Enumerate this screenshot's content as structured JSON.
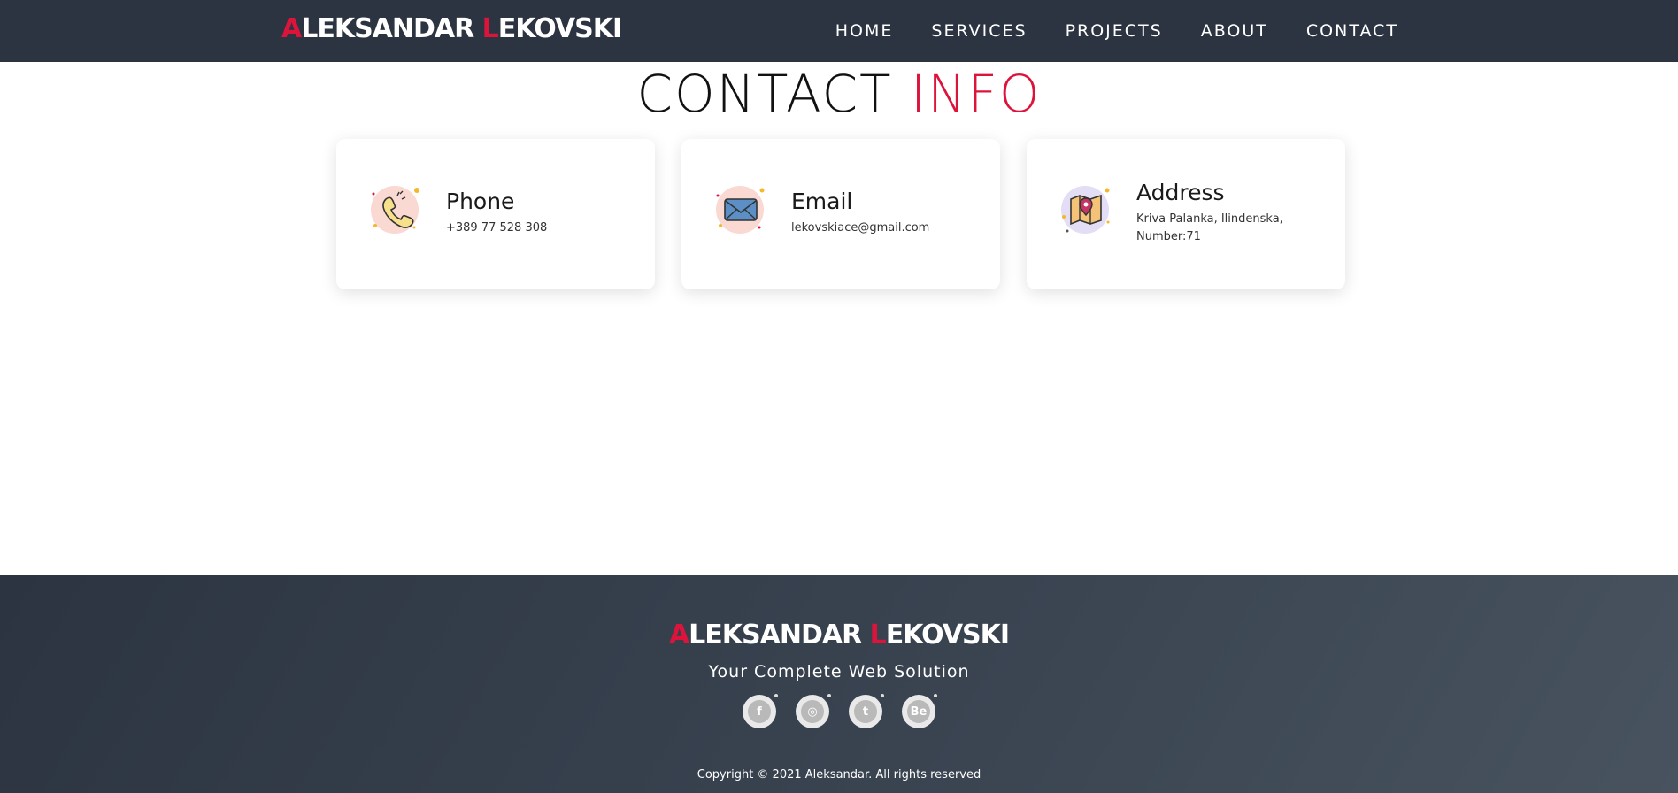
{
  "header": {
    "brand": {
      "a1": "A",
      "rest1": "LEKSANDAR ",
      "a2": "L",
      "rest2": "EKOVSKI"
    },
    "nav": [
      "HOME",
      "SERVICES",
      "PROJECTS",
      "ABOUT",
      "CONTACT"
    ]
  },
  "main": {
    "title_part1": "CONTACT ",
    "title_part2": "INFO",
    "cards": [
      {
        "icon": "phone-icon",
        "title": "Phone",
        "value": "+389 77 528 308"
      },
      {
        "icon": "mail-icon",
        "title": "Email",
        "value": "lekovskiace@gmail.com"
      },
      {
        "icon": "map-pin-icon",
        "title": "Address",
        "value": "Kriva Palanka, Ilindenska, Number:71"
      }
    ]
  },
  "footer": {
    "brand": {
      "a1": "A",
      "rest1": "LEKSANDAR ",
      "a2": "L",
      "rest2": "EKOVSKI"
    },
    "tagline": "Your Complete Web Solution",
    "socials": [
      {
        "icon": "facebook-icon",
        "glyph": "f"
      },
      {
        "icon": "instagram-icon",
        "glyph": "◎"
      },
      {
        "icon": "twitter-icon",
        "glyph": "t"
      },
      {
        "icon": "behance-icon",
        "glyph": "Be"
      }
    ],
    "copyright": "Copyright © 2021 Aleksandar. All rights reserved"
  },
  "colors": {
    "accent": "#dc143c",
    "header_bg": "#2c3441",
    "footer_bg": "#333c48"
  }
}
